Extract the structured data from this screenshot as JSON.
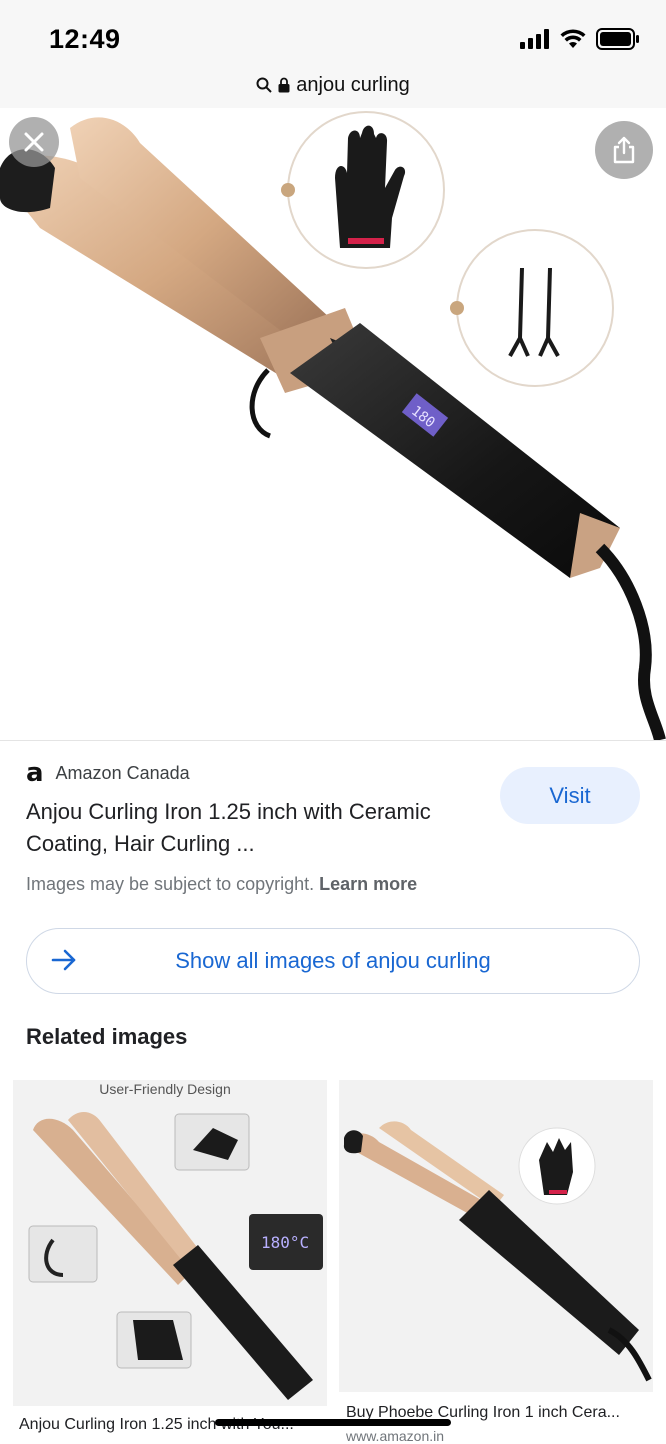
{
  "status_bar": {
    "time": "12:49"
  },
  "url_bar": {
    "url_text": "anjou curling",
    "search_icon": "search-icon",
    "lock_icon": "lock-icon"
  },
  "viewer": {
    "close_icon": "close-icon",
    "share_icon": "share-icon"
  },
  "result": {
    "source_logo": "a",
    "source_name": "Amazon Canada",
    "title": "Anjou Curling Iron 1.25 inch with Ceramic Coating, Hair Curling ...",
    "copyright_text": "Images may be subject to copyright.",
    "learn_more": "Learn more",
    "visit_label": "Visit"
  },
  "show_all": {
    "label": "Show all images of anjou curling",
    "icon": "arrow-right-icon"
  },
  "related": {
    "heading": "Related images",
    "items": [
      {
        "caption": "Anjou Curling Iron 1.25 inch with You...",
        "image_heading": "User-Friendly Design",
        "lcd_reading": "180°C"
      },
      {
        "caption": "Buy Phoebe Curling Iron 1 inch Cera...",
        "source": "www.amazon.in"
      }
    ]
  },
  "colors": {
    "accent": "#1967d2",
    "visit_bg": "#e8f0fe",
    "rose_gold": "#d9b08c",
    "iron_black": "#1b1b1b"
  }
}
